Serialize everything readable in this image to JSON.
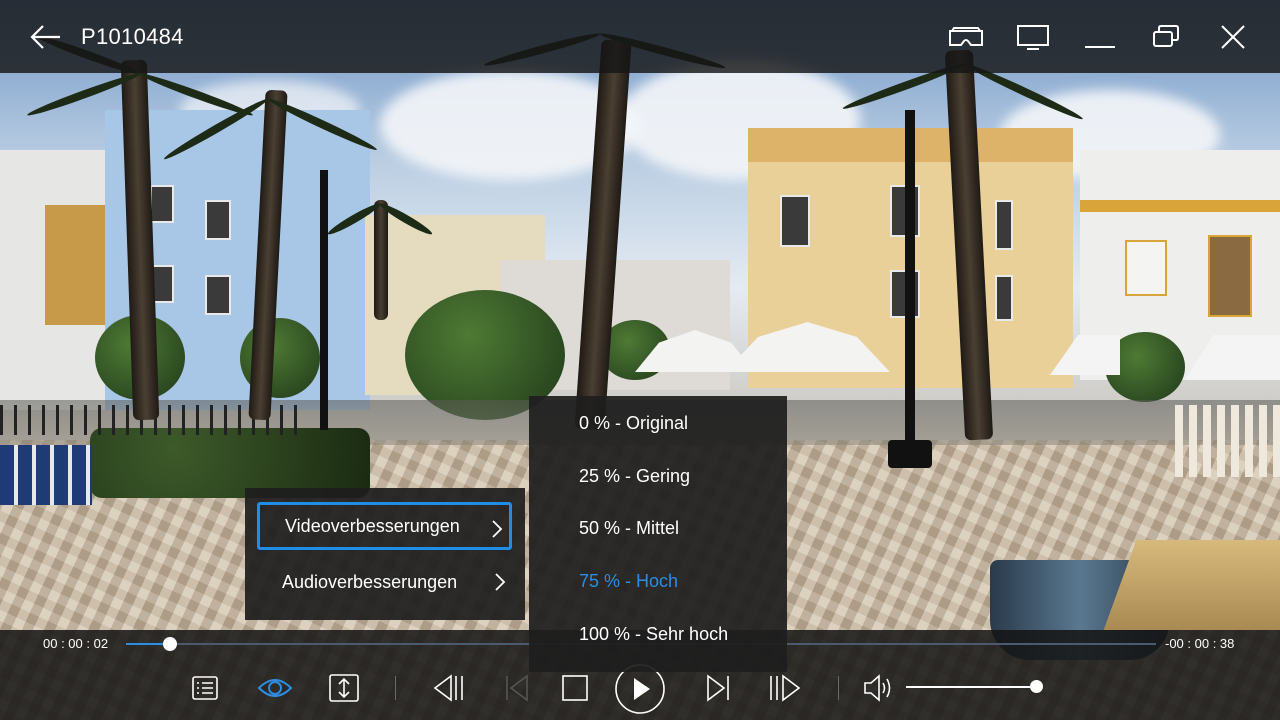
{
  "window": {
    "title": "P1010484",
    "back_icon": "arrow-left-icon",
    "buttons": [
      {
        "icon": "vr-headset-icon"
      },
      {
        "icon": "cast-to-device-icon"
      },
      {
        "icon": "minimize-icon"
      },
      {
        "icon": "restore-window-icon"
      },
      {
        "icon": "close-icon"
      }
    ]
  },
  "playback": {
    "elapsed": "00 : 00 : 02",
    "remaining": "-00 : 00 : 38",
    "progress": 0.043,
    "volume": 1.0,
    "accent_color": "#2e8de0"
  },
  "controls": [
    {
      "icon": "playlist-icon",
      "state": "normal"
    },
    {
      "icon": "eye-enhancements-icon",
      "state": "active"
    },
    {
      "icon": "aspect-ratio-icon",
      "state": "normal"
    },
    {
      "icon": "skip-back-icon",
      "state": "normal"
    },
    {
      "icon": "previous-track-icon",
      "state": "disabled"
    },
    {
      "icon": "stop-icon",
      "state": "normal"
    },
    {
      "icon": "play-icon",
      "state": "normal"
    },
    {
      "icon": "next-track-icon",
      "state": "normal"
    },
    {
      "icon": "skip-forward-icon",
      "state": "normal"
    },
    {
      "icon": "volume-icon",
      "state": "normal"
    }
  ],
  "enhancement_menu": {
    "items": [
      {
        "label": "Videoverbesserungen",
        "selected": true
      },
      {
        "label": "Audioverbesserungen",
        "selected": false
      }
    ],
    "submenu": {
      "items": [
        {
          "label": "0 % - Original",
          "active": false
        },
        {
          "label": "25 % - Gering",
          "active": false
        },
        {
          "label": "50 % - Mittel",
          "active": false
        },
        {
          "label": "75 % - Hoch",
          "active": true
        },
        {
          "label": "100 % - Sehr hoch",
          "active": false
        }
      ],
      "active_color": "#2a8ee3"
    },
    "selection_color": "#1e8ee6"
  }
}
